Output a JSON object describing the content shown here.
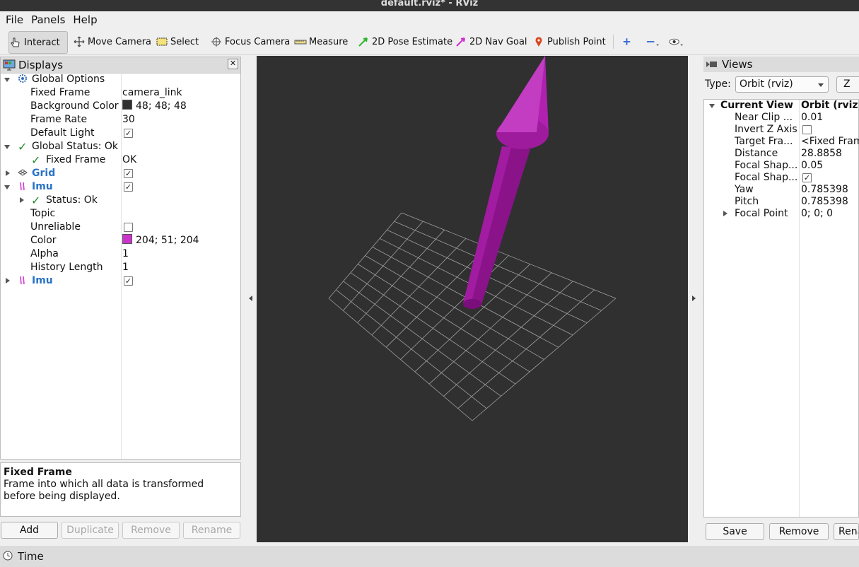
{
  "window": {
    "title": "default.rviz* - RViz"
  },
  "menu": [
    "File",
    "Panels",
    "Help"
  ],
  "toolbar": {
    "interact": "Interact",
    "move_camera": "Move Camera",
    "select": "Select",
    "focus_camera": "Focus Camera",
    "measure": "Measure",
    "pose_estimate": "2D Pose Estimate",
    "nav_goal": "2D Nav Goal",
    "publish_point": "Publish Point"
  },
  "displays": {
    "title": "Displays",
    "rows": {
      "global_options": "Global Options",
      "fixed_frame": "Fixed Frame",
      "fixed_frame_val": "camera_link",
      "background_color": "Background Color",
      "background_color_val": "48; 48; 48",
      "frame_rate": "Frame Rate",
      "frame_rate_val": "30",
      "default_light": "Default Light",
      "global_status": "Global Status: Ok",
      "status_fixed_frame": "Fixed Frame",
      "status_fixed_frame_val": "OK",
      "grid": "Grid",
      "imu": "Imu",
      "status_ok": "Status: Ok",
      "topic": "Topic",
      "unreliable": "Unreliable",
      "color": "Color",
      "color_val": "204; 51; 204",
      "alpha": "Alpha",
      "alpha_val": "1",
      "history_length": "History Length",
      "history_length_val": "1",
      "imu2": "Imu"
    },
    "background_color_hex": "#303030",
    "imu_color_hex": "#cc33cc"
  },
  "description": {
    "title": "Fixed Frame",
    "text": "Frame into which all data is transformed before being displayed."
  },
  "display_buttons": {
    "add": "Add",
    "duplicate": "Duplicate",
    "remove": "Remove",
    "rename": "Rename"
  },
  "views": {
    "title": "Views",
    "type_label": "Type:",
    "type_value": "Orbit (rviz)",
    "zero_label": "Z",
    "current_view": "Current View",
    "current_view_val": "Orbit (rviz)",
    "rows": {
      "near_clip": "Near Clip ...",
      "near_clip_val": "0.01",
      "invert_z": "Invert Z Axis",
      "target_frame": "Target Fra...",
      "target_frame_val": "<Fixed Frame>",
      "distance": "Distance",
      "distance_val": "28.8858",
      "focal_shape_size": "Focal Shap...",
      "focal_shape_size_val": "0.05",
      "focal_shape_fixed": "Focal Shap...",
      "yaw": "Yaw",
      "yaw_val": "0.785398",
      "pitch": "Pitch",
      "pitch_val": "0.785398",
      "focal_point": "Focal Point",
      "focal_point_val": "0; 0; 0"
    },
    "save": "Save",
    "remove": "Remove",
    "rename": "Rename"
  },
  "status": {
    "time": "Time"
  }
}
